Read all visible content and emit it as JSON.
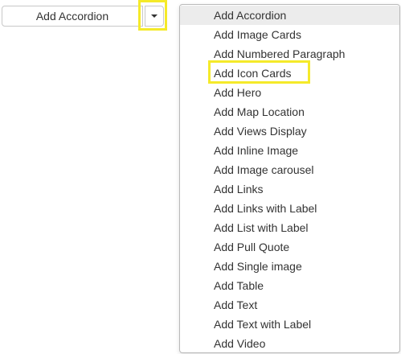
{
  "split_button": {
    "main_label": "Add Accordion",
    "toggle_icon": "caret-down-icon"
  },
  "highlight_color": "#f5ea2a",
  "dropdown": {
    "selected_index": 0,
    "items": [
      {
        "label": "Add Accordion"
      },
      {
        "label": "Add Image Cards"
      },
      {
        "label": "Add Numbered Paragraph"
      },
      {
        "label": "Add Icon Cards"
      },
      {
        "label": "Add Hero"
      },
      {
        "label": "Add Map Location"
      },
      {
        "label": "Add Views Display"
      },
      {
        "label": "Add Inline Image"
      },
      {
        "label": "Add Image carousel"
      },
      {
        "label": "Add Links"
      },
      {
        "label": "Add Links with Label"
      },
      {
        "label": "Add List with Label"
      },
      {
        "label": "Add Pull Quote"
      },
      {
        "label": "Add Single image"
      },
      {
        "label": "Add Table"
      },
      {
        "label": "Add Text"
      },
      {
        "label": "Add Text with Label"
      },
      {
        "label": "Add Video"
      }
    ]
  }
}
